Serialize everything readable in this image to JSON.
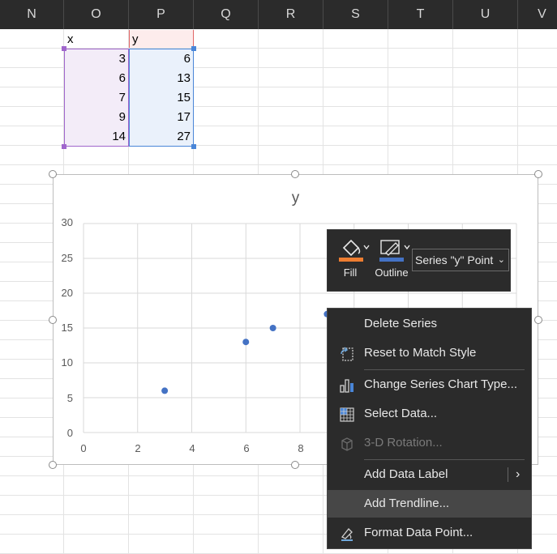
{
  "columns": [
    "N",
    "O",
    "P",
    "Q",
    "R",
    "S",
    "T",
    "U",
    "V"
  ],
  "table": {
    "headers": {
      "x": "x",
      "y": "y"
    },
    "x": [
      "3",
      "6",
      "7",
      "9",
      "14"
    ],
    "y": [
      "6",
      "13",
      "15",
      "17",
      "27"
    ]
  },
  "chart": {
    "title": "y",
    "y_ticks": [
      "30",
      "25",
      "20",
      "15",
      "10",
      "5",
      "0"
    ],
    "x_ticks": [
      "0",
      "2",
      "4",
      "6",
      "8"
    ]
  },
  "chart_data": {
    "type": "scatter",
    "title": "y",
    "x": [
      3,
      6,
      7,
      9,
      14
    ],
    "y": [
      6,
      13,
      15,
      17,
      27
    ],
    "xlim": [
      0,
      16
    ],
    "ylim": [
      0,
      30
    ],
    "grid": true,
    "marker_color": "#4472c4"
  },
  "mini_toolbar": {
    "fill_label": "Fill",
    "outline_label": "Outline",
    "selector_value": "Series \"y\" Point",
    "fill_color": "#ed7d31",
    "outline_color": "#4472c4"
  },
  "context_menu": {
    "items": [
      {
        "label": "Delete Series",
        "icon": "none",
        "disabled": false
      },
      {
        "label": "Reset to Match Style",
        "icon": "reset-icon",
        "disabled": false
      },
      {
        "label": "Change Series Chart Type...",
        "icon": "chart-type-icon",
        "disabled": false
      },
      {
        "label": "Select Data...",
        "icon": "select-data-icon",
        "disabled": false
      },
      {
        "label": "3-D Rotation...",
        "icon": "rotation-3d-icon",
        "disabled": true
      },
      {
        "label": "Add Data Label",
        "icon": "none",
        "disabled": false,
        "submenu": true
      },
      {
        "label": "Add Trendline...",
        "icon": "none",
        "disabled": false
      },
      {
        "label": "Format Data Point...",
        "icon": "format-icon",
        "disabled": false
      }
    ]
  }
}
